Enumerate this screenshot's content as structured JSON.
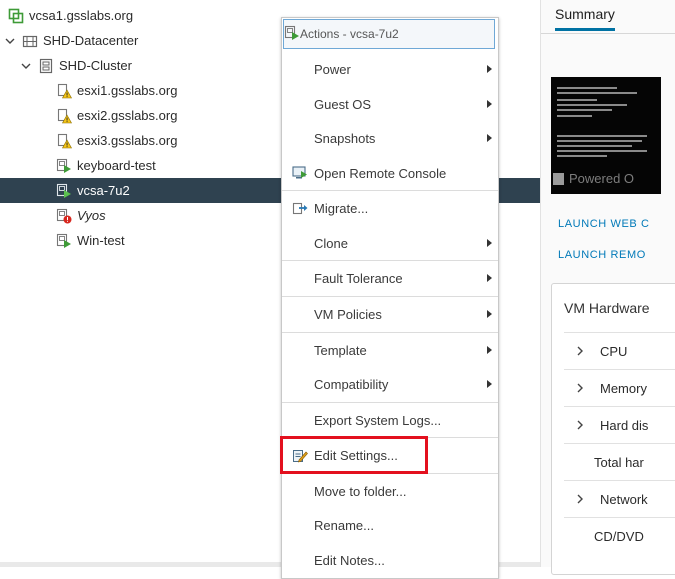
{
  "tree": {
    "items": [
      {
        "label": "vcsa1.gsslabs.org",
        "icon": "vcenter-icon",
        "toggle": "",
        "italic": false
      },
      {
        "label": "SHD-Datacenter",
        "icon": "datacenter-icon",
        "toggle": "expanded",
        "italic": false
      },
      {
        "label": "SHD-Cluster",
        "icon": "cluster-icon",
        "toggle": "expanded",
        "italic": false
      },
      {
        "label": "esxi1.gsslabs.org",
        "icon": "host-warning-icon",
        "toggle": "",
        "italic": false
      },
      {
        "label": "esxi2.gsslabs.org",
        "icon": "host-warning-icon",
        "toggle": "",
        "italic": false
      },
      {
        "label": "esxi3.gsslabs.org",
        "icon": "host-warning-icon",
        "toggle": "",
        "italic": false
      },
      {
        "label": "keyboard-test",
        "icon": "vm-powered-on-icon",
        "toggle": "",
        "italic": false
      },
      {
        "label": "vcsa-7u2",
        "icon": "vm-powered-on-icon",
        "toggle": "",
        "italic": false,
        "selected": true
      },
      {
        "label": "Vyos",
        "icon": "vm-error-icon",
        "toggle": "",
        "italic": true
      },
      {
        "label": "Win-test",
        "icon": "vm-powered-on-icon",
        "toggle": "",
        "italic": false
      }
    ]
  },
  "context_menu": {
    "header": "Actions - vcsa-7u2",
    "items": [
      {
        "label": "Power",
        "submenu": true,
        "icon": ""
      },
      {
        "label": "Guest OS",
        "submenu": true,
        "icon": ""
      },
      {
        "label": "Snapshots",
        "submenu": true,
        "icon": ""
      },
      {
        "label": "Open Remote Console",
        "submenu": false,
        "icon": "remote-console-icon"
      },
      {
        "label": "Migrate...",
        "submenu": false,
        "icon": "migrate-icon"
      },
      {
        "label": "Clone",
        "submenu": true,
        "icon": ""
      },
      {
        "label": "Fault Tolerance",
        "submenu": true,
        "icon": ""
      },
      {
        "label": "VM Policies",
        "submenu": true,
        "icon": ""
      },
      {
        "label": "Template",
        "submenu": true,
        "icon": ""
      },
      {
        "label": "Compatibility",
        "submenu": true,
        "icon": ""
      },
      {
        "label": "Export System Logs...",
        "submenu": false,
        "icon": ""
      },
      {
        "label": "Edit Settings...",
        "submenu": false,
        "icon": "edit-settings-icon",
        "highlighted": true
      },
      {
        "label": "Move to folder...",
        "submenu": false,
        "icon": ""
      },
      {
        "label": "Rename...",
        "submenu": false,
        "icon": ""
      },
      {
        "label": "Edit Notes...",
        "submenu": false,
        "icon": ""
      }
    ]
  },
  "summary": {
    "tab_label": "Summary",
    "console_status": "Powered O",
    "launch_web": "LAUNCH WEB C",
    "launch_remote": "LAUNCH REMO",
    "hardware": {
      "title": "VM Hardware",
      "rows": [
        {
          "label": "CPU",
          "expandable": true
        },
        {
          "label": "Memory",
          "expandable": true
        },
        {
          "label": "Hard dis",
          "expandable": true
        },
        {
          "label": "Total har",
          "expandable": false
        },
        {
          "label": "Network",
          "expandable": true
        },
        {
          "label": "CD/DVD",
          "expandable": false
        }
      ]
    }
  },
  "colors": {
    "selected_row": "#2f4250",
    "accent": "#0072a3",
    "link": "#0079b8",
    "highlight_box": "#e3101e",
    "vm_green": "#3e9b37",
    "warning_yellow": "#f5c518"
  }
}
